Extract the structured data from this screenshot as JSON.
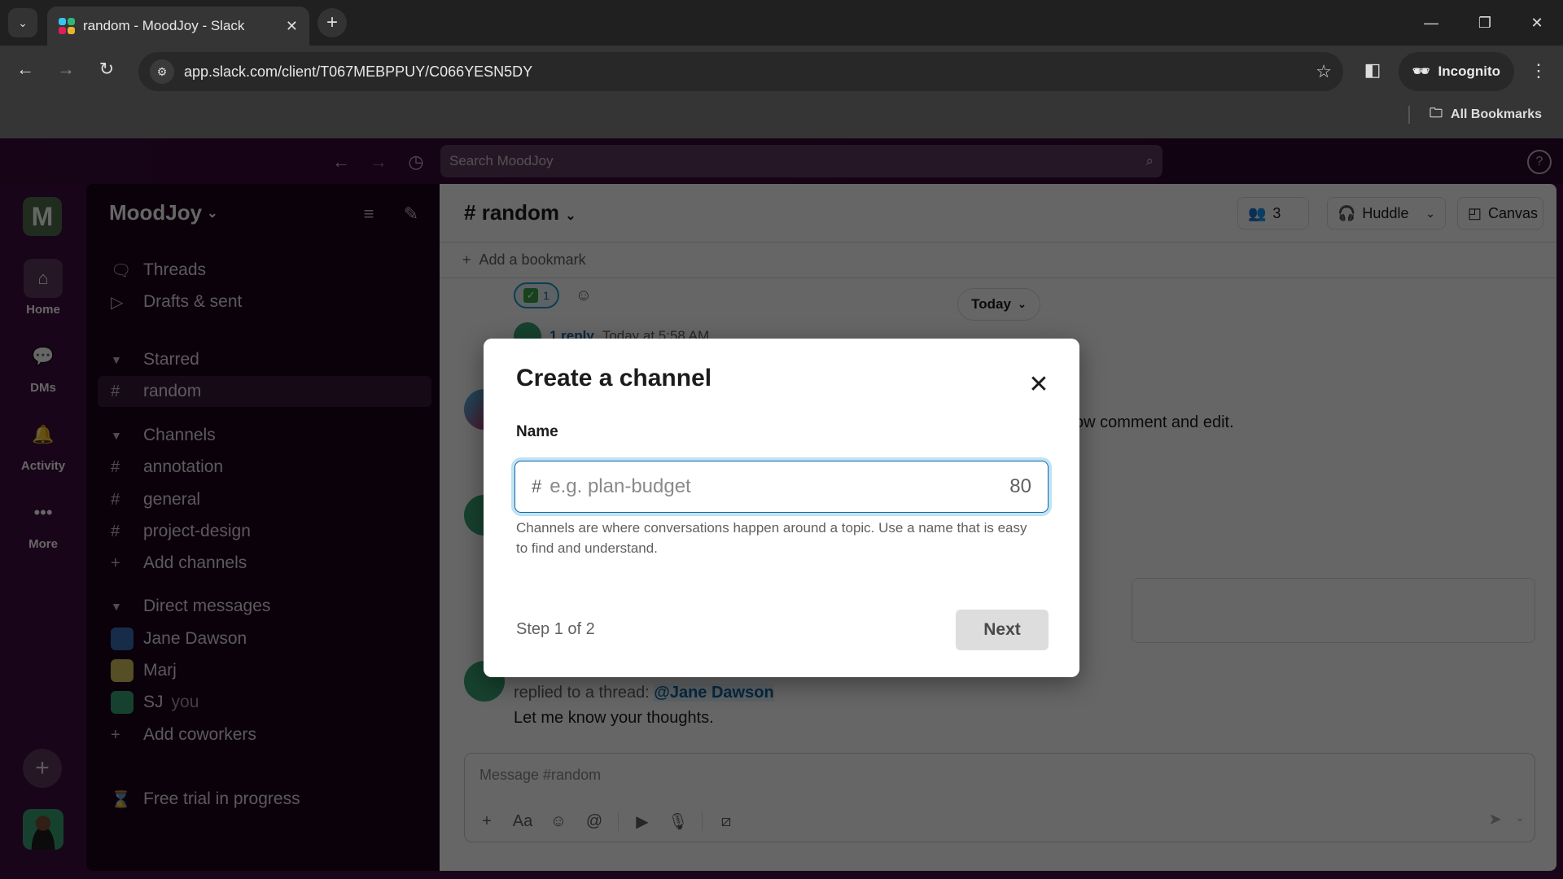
{
  "browser": {
    "tab_title": "random - MoodJoy - Slack",
    "url": "app.slack.com/client/T067MEBPPUY/C066YESN5DY",
    "incognito_label": "Incognito",
    "all_bookmarks_label": "All Bookmarks"
  },
  "slack": {
    "search_placeholder": "Search MoodJoy",
    "workspace_initial": "M",
    "workspace_name": "MoodJoy",
    "rail": [
      {
        "label": "Home",
        "icon": "home-icon"
      },
      {
        "label": "DMs",
        "icon": "dms-icon"
      },
      {
        "label": "Activity",
        "icon": "bell-icon"
      },
      {
        "label": "More",
        "icon": "more-icon"
      }
    ],
    "sidebar": {
      "threads": "Threads",
      "drafts": "Drafts & sent",
      "starred_header": "Starred",
      "starred": [
        "random"
      ],
      "channels_header": "Channels",
      "channels": [
        "annotation",
        "general",
        "project-design"
      ],
      "add_channels": "Add channels",
      "dm_header": "Direct messages",
      "dms": [
        {
          "name": "Jane Dawson",
          "suffix": ""
        },
        {
          "name": "Marj",
          "suffix": ""
        },
        {
          "name": "SJ",
          "suffix": "you"
        }
      ],
      "add_coworkers": "Add coworkers",
      "free_trial": "Free trial in progress"
    },
    "channel": {
      "hash": "#",
      "name": "random",
      "member_count": "3",
      "huddle_label": "Huddle",
      "canvas_label": "Canvas",
      "add_bookmark": "Add a bookmark",
      "reaction_count": "1",
      "reply_count_label": "1 reply",
      "reply_time": "Today at 5:58 AM",
      "date_divider": "Today",
      "bg_text_fragment": "ow comment and edit.",
      "thread_reply_prefix": "replied to a thread:",
      "thread_reply_mention": "@Jane Dawson",
      "thread_reply_text": "Let me know your thoughts.",
      "composer_placeholder": "Message #random"
    }
  },
  "modal": {
    "title": "Create a channel",
    "name_label": "Name",
    "name_prefix": "#",
    "name_value": "",
    "name_placeholder": "e.g. plan-budget",
    "char_remaining": "80",
    "help_text": "Channels are where conversations happen around a topic. Use a name that is easy to find and understand.",
    "step_text": "Step 1 of 2",
    "next_label": "Next"
  },
  "colors": {
    "aubergine": "#3f0e40",
    "sidebar_bg": "#190319",
    "link_blue": "#1264a3",
    "focus_ring": "#bfe3f3"
  }
}
